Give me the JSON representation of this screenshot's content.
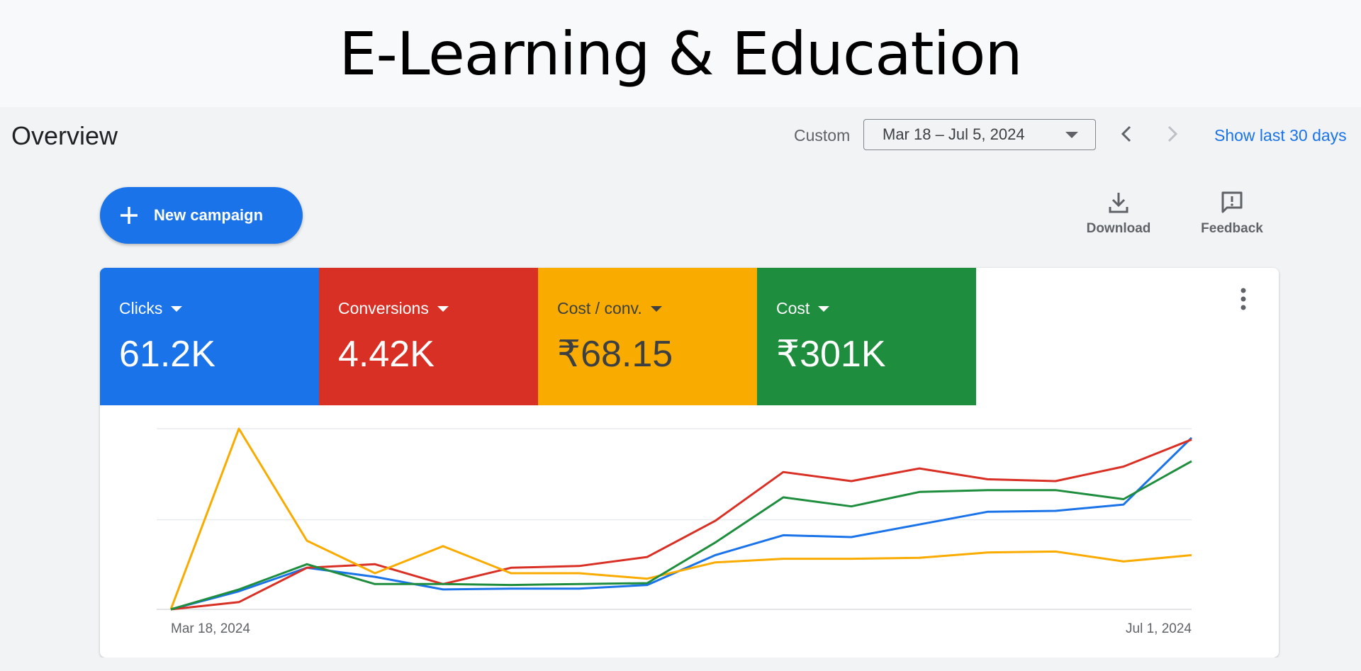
{
  "banner": {
    "title": "E-Learning & Education"
  },
  "header": {
    "title": "Overview",
    "range_type": "Custom",
    "date_range": "Mar 18 – Jul 5, 2024",
    "show_last": "Show last 30 days"
  },
  "actions": {
    "new_campaign": "New campaign",
    "download": "Download",
    "feedback": "Feedback"
  },
  "metrics": [
    {
      "label": "Clicks",
      "value": "61.2K",
      "color": "#1a73e8",
      "text": "#ffffff"
    },
    {
      "label": "Conversions",
      "value": "4.42K",
      "color": "#d93025",
      "text": "#ffffff"
    },
    {
      "label": "Cost / conv.",
      "value": "₹68.15",
      "color": "#f9ab00",
      "text": "#3c4043"
    },
    {
      "label": "Cost",
      "value": "₹301K",
      "color": "#1e8e3e",
      "text": "#ffffff"
    }
  ],
  "chart_data": {
    "type": "line",
    "x_labels": [
      "Mar 18, 2024",
      "Jul 1, 2024"
    ],
    "grid": true,
    "y_relative": true,
    "series": [
      {
        "metric": "Clicks",
        "color": "#1a73e8",
        "values": [
          0,
          0.1,
          0.23,
          0.18,
          0.11,
          0.115,
          0.115,
          0.135,
          0.3,
          0.41,
          0.4,
          0.47,
          0.54,
          0.545,
          0.58,
          0.95
        ]
      },
      {
        "metric": "Conversions",
        "color": "#d93025",
        "values": [
          0,
          0.04,
          0.23,
          0.25,
          0.14,
          0.23,
          0.24,
          0.29,
          0.49,
          0.76,
          0.71,
          0.78,
          0.72,
          0.71,
          0.79,
          0.94
        ]
      },
      {
        "metric": "Cost / conv.",
        "color": "#f9ab00",
        "values": [
          0,
          1.0,
          0.38,
          0.2,
          0.35,
          0.2,
          0.2,
          0.17,
          0.26,
          0.28,
          0.28,
          0.285,
          0.315,
          0.32,
          0.265,
          0.3
        ]
      },
      {
        "metric": "Cost",
        "color": "#1e8e3e",
        "values": [
          0,
          0.11,
          0.25,
          0.14,
          0.14,
          0.135,
          0.14,
          0.145,
          0.37,
          0.62,
          0.57,
          0.65,
          0.66,
          0.66,
          0.61,
          0.82
        ]
      }
    ]
  }
}
